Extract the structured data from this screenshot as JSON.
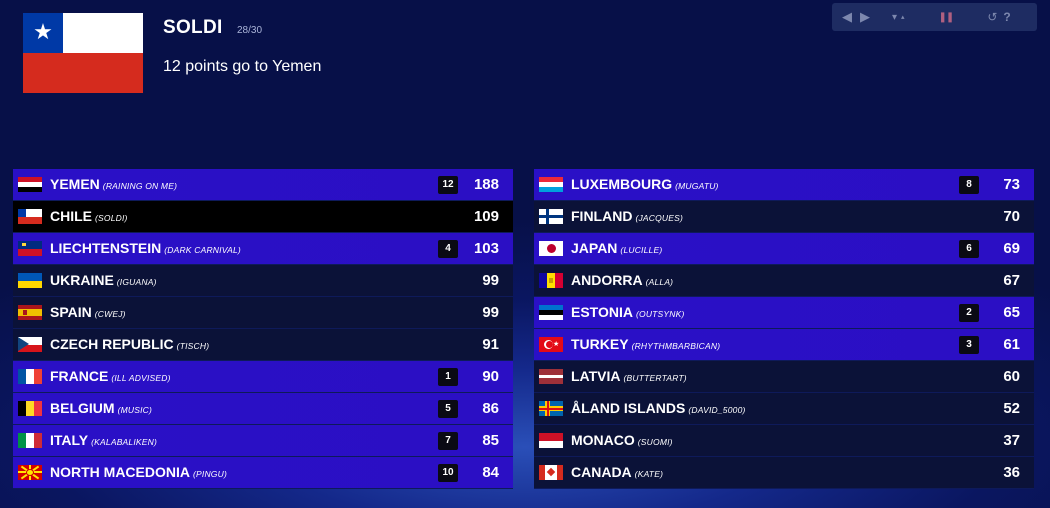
{
  "voter": {
    "name": "SOLDI",
    "progress": "28/30",
    "announcement": "12 points go to Yemen",
    "flag": "chile"
  },
  "controls": {
    "prev_icon": "◀",
    "next_icon": "▶",
    "sort_icon": "▾",
    "sort_up_icon": "▴",
    "pause_icon": "❚❚",
    "reset_icon": "↺",
    "help_icon": "?"
  },
  "left_column": [
    {
      "country": "YEMEN",
      "song": "(RAINING ON ME)",
      "points": "12",
      "total": "188",
      "flag": "yemen",
      "style": "bright"
    },
    {
      "country": "CHILE",
      "song": "(SOLDI)",
      "points": "",
      "total": "109",
      "flag": "chile",
      "style": "voter"
    },
    {
      "country": "LIECHTENSTEIN",
      "song": "(DARK CARNIVAL)",
      "points": "4",
      "total": "103",
      "flag": "liechtenstein",
      "style": "bright"
    },
    {
      "country": "UKRAINE",
      "song": "(IGUANA)",
      "points": "",
      "total": "99",
      "flag": "ukraine",
      "style": "dim"
    },
    {
      "country": "SPAIN",
      "song": "(CWEJ)",
      "points": "",
      "total": "99",
      "flag": "spain",
      "style": "dim"
    },
    {
      "country": "CZECH REPUBLIC",
      "song": "(TISCH)",
      "points": "",
      "total": "91",
      "flag": "czech",
      "style": "dim"
    },
    {
      "country": "FRANCE",
      "song": "(ILL ADVISED)",
      "points": "1",
      "total": "90",
      "flag": "france",
      "style": "bright"
    },
    {
      "country": "BELGIUM",
      "song": "(MUSIC)",
      "points": "5",
      "total": "86",
      "flag": "belgium",
      "style": "bright"
    },
    {
      "country": "ITALY",
      "song": "(KALABALIKEN)",
      "points": "7",
      "total": "85",
      "flag": "italy",
      "style": "bright"
    },
    {
      "country": "NORTH MACEDONIA",
      "song": "(PINGU)",
      "points": "10",
      "total": "84",
      "flag": "macedonia",
      "style": "bright"
    }
  ],
  "right_column": [
    {
      "country": "LUXEMBOURG",
      "song": "(MUGATU)",
      "points": "8",
      "total": "73",
      "flag": "luxembourg",
      "style": "bright"
    },
    {
      "country": "FINLAND",
      "song": "(JACQUES)",
      "points": "",
      "total": "70",
      "flag": "finland",
      "style": "dim"
    },
    {
      "country": "JAPAN",
      "song": "(LUCILLE)",
      "points": "6",
      "total": "69",
      "flag": "japan",
      "style": "bright"
    },
    {
      "country": "ANDORRA",
      "song": "(ALLA)",
      "points": "",
      "total": "67",
      "flag": "andorra",
      "style": "dim"
    },
    {
      "country": "ESTONIA",
      "song": "(OUTSYNK)",
      "points": "2",
      "total": "65",
      "flag": "estonia",
      "style": "bright"
    },
    {
      "country": "TURKEY",
      "song": "(RHYTHMBARBICAN)",
      "points": "3",
      "total": "61",
      "flag": "turkey",
      "style": "bright"
    },
    {
      "country": "LATVIA",
      "song": "(BUTTERTART)",
      "points": "",
      "total": "60",
      "flag": "latvia",
      "style": "dim"
    },
    {
      "country": "ÅLAND ISLANDS",
      "song": "(DAVID_5000)",
      "points": "",
      "total": "52",
      "flag": "aland",
      "style": "dim"
    },
    {
      "country": "MONACO",
      "song": "(SUOMI)",
      "points": "",
      "total": "37",
      "flag": "monaco",
      "style": "dim"
    },
    {
      "country": "CANADA",
      "song": "(KATE)",
      "points": "",
      "total": "36",
      "flag": "canada",
      "style": "dim"
    }
  ]
}
